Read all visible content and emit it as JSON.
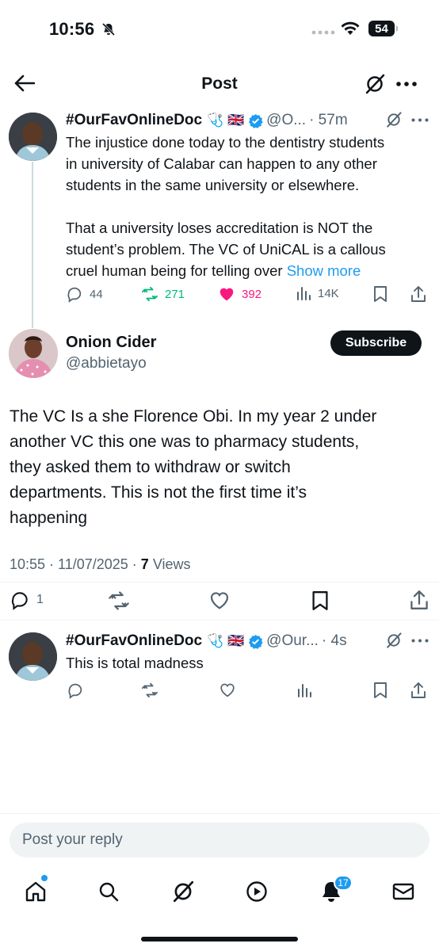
{
  "status_bar": {
    "time": "10:56",
    "battery": "54"
  },
  "header": {
    "title": "Post"
  },
  "parent_tweet": {
    "name": "#OurFavOnlineDoc",
    "emoji": "🩺 🇬🇧",
    "handle": "@O...",
    "time": "· 57m",
    "text_lines": [
      "The injustice done today to the dentistry students",
      "in university of Calabar can happen to any other",
      "students in the same university or elsewhere.",
      "",
      "That a university loses accreditation is NOT the",
      "student’s problem. The VC of UniCAL is a callous",
      "cruel human being for telling over"
    ],
    "show_more": "Show more",
    "stats": {
      "replies": "44",
      "reposts": "271",
      "likes": "392",
      "views": "14K"
    }
  },
  "main_tweet": {
    "name": "Onion Cider",
    "handle": "@abbietayo",
    "subscribe_label": "Subscribe",
    "text_lines": [
      "The VC Is a she Florence Obi. In my year 2 under",
      "another VC this one was to pharmacy students,",
      "they asked them to withdraw or switch",
      "departments. This is not the first time it’s",
      "happening"
    ],
    "meta": "10:55 · 11/07/2025 · ",
    "views_count": "7",
    "views_label": "Views",
    "replies": "1"
  },
  "reply_tweet": {
    "name": "#OurFavOnlineDoc",
    "emoji": "🩺 🇬🇧",
    "handle": "@Our...",
    "time": "· 4s",
    "text": "This is total madness"
  },
  "reply_input": {
    "placeholder": "Post your reply"
  },
  "bottom_nav": {
    "notifications_badge": "17"
  },
  "colors": {
    "accent": "#1d9bf0",
    "repost": "#00ba7c",
    "like": "#f91880",
    "text": "#0f1419",
    "muted": "#536471"
  }
}
